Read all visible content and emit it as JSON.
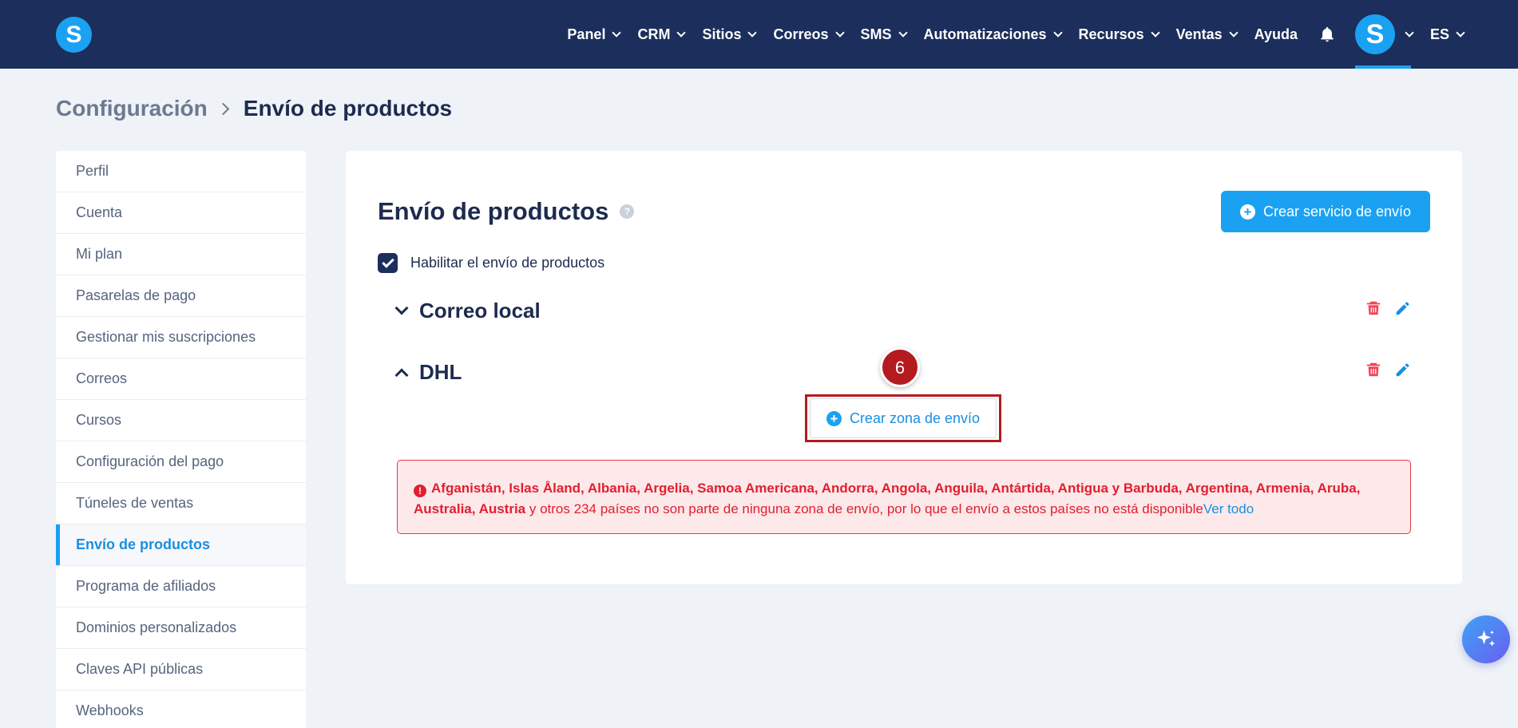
{
  "nav": {
    "items": [
      {
        "label": "Panel",
        "has_dropdown": true
      },
      {
        "label": "CRM",
        "has_dropdown": true
      },
      {
        "label": "Sitios",
        "has_dropdown": true
      },
      {
        "label": "Correos",
        "has_dropdown": true
      },
      {
        "label": "SMS",
        "has_dropdown": true
      },
      {
        "label": "Automatizaciones",
        "has_dropdown": true
      },
      {
        "label": "Recursos",
        "has_dropdown": true
      },
      {
        "label": "Ventas",
        "has_dropdown": true
      },
      {
        "label": "Ayuda",
        "has_dropdown": false
      }
    ],
    "logo_letter": "S",
    "avatar_letter": "S",
    "language": "ES",
    "icons": {
      "notifications": "bell-icon"
    }
  },
  "breadcrumb": {
    "root": "Configuración",
    "current": "Envío de productos"
  },
  "sidebar": {
    "items": [
      {
        "label": "Perfil",
        "active": false
      },
      {
        "label": "Cuenta",
        "active": false
      },
      {
        "label": "Mi plan",
        "active": false
      },
      {
        "label": "Pasarelas de pago",
        "active": false
      },
      {
        "label": "Gestionar mis suscripciones",
        "active": false
      },
      {
        "label": "Correos",
        "active": false
      },
      {
        "label": "Cursos",
        "active": false
      },
      {
        "label": "Configuración del pago",
        "active": false
      },
      {
        "label": "Túneles de ventas",
        "active": false
      },
      {
        "label": "Envío de productos",
        "active": true
      },
      {
        "label": "Programa de afiliados",
        "active": false
      },
      {
        "label": "Dominios personalizados",
        "active": false
      },
      {
        "label": "Claves API públicas",
        "active": false
      },
      {
        "label": "Webhooks",
        "active": false
      }
    ]
  },
  "main": {
    "title": "Envío de productos",
    "help_glyph": "?",
    "create_service_label": "Crear servicio de envío",
    "enable_label": "Habilitar el envío de productos",
    "enable_checked": true,
    "services": [
      {
        "name": "Correo local",
        "expanded": false
      },
      {
        "name": "DHL",
        "expanded": true
      }
    ],
    "create_zone_label": "Crear zona de envío",
    "step_number": "6",
    "alert": {
      "countries": "Afganistán, Islas Åland, Albania, Argelia, Samoa Americana, Andorra, Angola, Anguila, Antártida, Antigua y Barbuda, Argentina, Armenia, Aruba, Australia, Austria",
      "message": " y otros 234 países no son parte de ninguna zona de envío, por lo que el envío a estos países no está disponible",
      "link": "Ver todo",
      "icon_glyph": "!"
    }
  },
  "colors": {
    "topbar": "#1b2e5c",
    "accent": "#1aa1f2",
    "danger": "#e0202f",
    "highlight": "#b31b1f"
  }
}
